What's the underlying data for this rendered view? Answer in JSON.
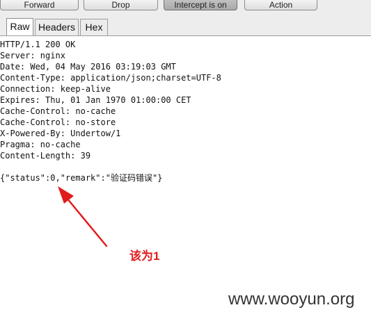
{
  "toolbar": {
    "forward_label": "Forward",
    "drop_label": "Drop",
    "intercept_label": "Intercept is on",
    "action_label": "Action"
  },
  "tabs": [
    {
      "label": "Raw"
    },
    {
      "label": "Headers"
    },
    {
      "label": "Hex"
    }
  ],
  "response": {
    "lines": [
      "HTTP/1.1 200 OK",
      "Server: nginx",
      "Date: Wed, 04 May 2016 03:19:03 GMT",
      "Content-Type: application/json;charset=UTF-8",
      "Connection: keep-alive",
      "Expires: Thu, 01 Jan 1970 01:00:00 CET",
      "Cache-Control: no-cache",
      "Cache-Control: no-store",
      "X-Powered-By: Undertow/1",
      "Pragma: no-cache",
      "Content-Length: 39",
      "",
      "{\"status\":0,\"remark\":\"验证码错误\"}"
    ]
  },
  "annotation": {
    "text": "该为1",
    "color": "#e21b1b"
  },
  "watermark": {
    "text": "www.wooyun.org"
  }
}
